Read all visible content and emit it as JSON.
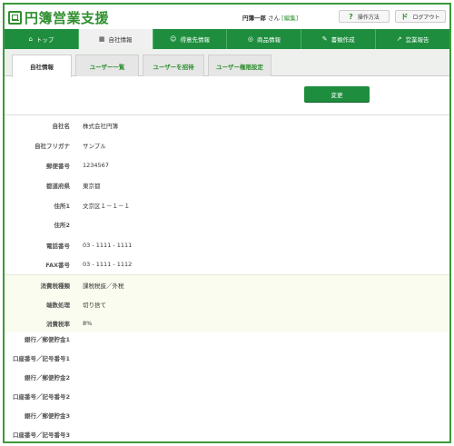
{
  "header": {
    "logo_text": "円簿営業支援",
    "user_name": "円簿一郎",
    "user_suffix": "さん",
    "edit_link": "[編集]",
    "help_icon": "?",
    "help_label": "操作方法",
    "logout_icon": "ド",
    "logout_label": "ログアウト"
  },
  "nav": {
    "items": [
      {
        "icon": "⌂",
        "label": "トップ"
      },
      {
        "icon": "▦",
        "label": "自社情報"
      },
      {
        "icon": "☺",
        "label": "得意先情報"
      },
      {
        "icon": "◎",
        "label": "商品情報"
      },
      {
        "icon": "✎",
        "label": "書類作成"
      },
      {
        "icon": "↗",
        "label": "営業報告"
      }
    ]
  },
  "subtabs": [
    "自社情報",
    "ユーザー一覧",
    "ユーザーを招待",
    "ユーザー権限設定"
  ],
  "change_button": "変更",
  "fields": [
    {
      "label": "自社名",
      "value": "株式会社円簿"
    },
    {
      "label": "自社フリガナ",
      "value": "サンプル"
    },
    {
      "label": "郵便番号",
      "value": "1234567"
    },
    {
      "label": "都道府県",
      "value": "東京都"
    },
    {
      "label": "住所1",
      "value": "文京区１－１－１"
    },
    {
      "label": "住所2",
      "value": ""
    },
    {
      "label": "電話番号",
      "value": "03 - 1111 - 1111"
    },
    {
      "label": "FAX番号",
      "value": "03 - 1111 - 1112"
    },
    {
      "label": "消費税種類",
      "value": "課税税抜／外税"
    },
    {
      "label": "端数処理",
      "value": "切り捨て"
    },
    {
      "label": "消費税率",
      "value": "8%"
    },
    {
      "label": "銀行／郵便貯金1",
      "value": ""
    },
    {
      "label": "口座番号／記号番号1",
      "value": ""
    },
    {
      "label": "銀行／郵便貯金2",
      "value": ""
    },
    {
      "label": "口座番号／記号番号2",
      "value": ""
    },
    {
      "label": "銀行／郵便貯金3",
      "value": ""
    },
    {
      "label": "口座番号／記号番号3",
      "value": ""
    }
  ],
  "colors": {
    "brand": "#1e8e3e",
    "border": "#3a9a3a"
  }
}
